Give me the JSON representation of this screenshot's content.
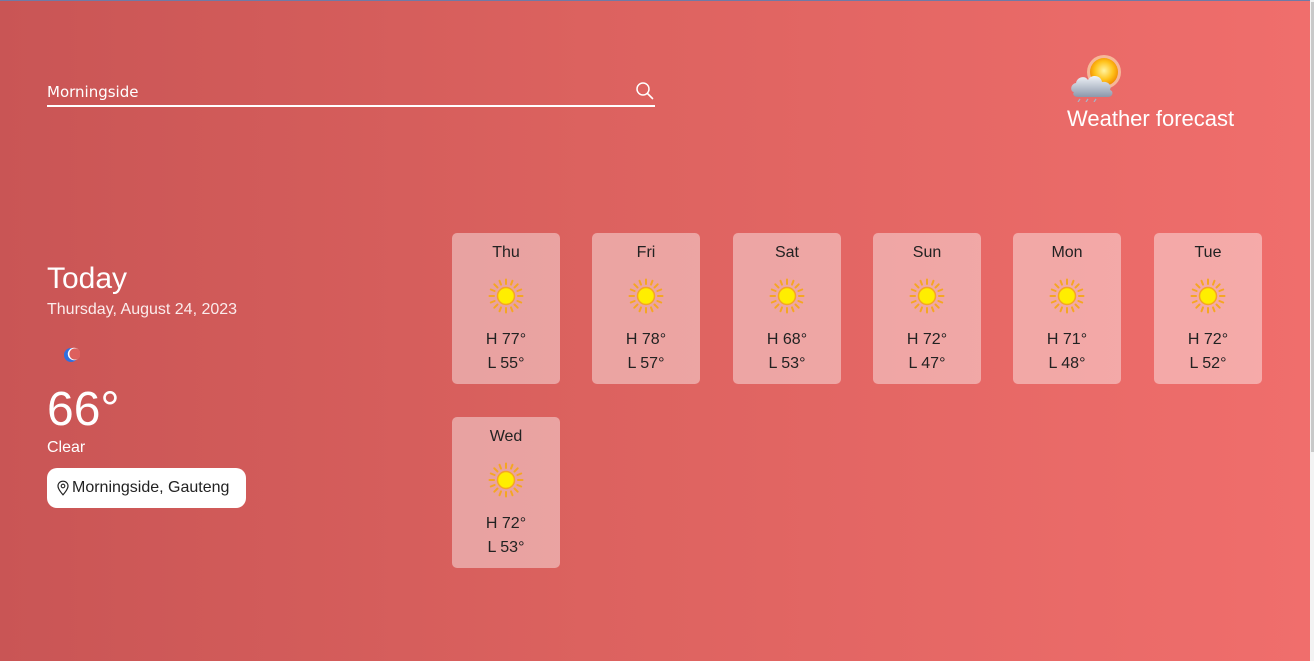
{
  "search": {
    "value": "Morningside",
    "placeholder": ""
  },
  "brand": {
    "title": "Weather forecast",
    "logo": "sun-behind-cloud-icon"
  },
  "today": {
    "title": "Today",
    "date": "Thursday, August 24, 2023",
    "icon": "moon-icon",
    "temperature": "66°",
    "condition": "Clear",
    "location": "Morningside, Gauteng"
  },
  "forecast": [
    {
      "day": "Thu",
      "high": "H 77°",
      "low": "L 55°",
      "icon": "sun-icon"
    },
    {
      "day": "Fri",
      "high": "H 78°",
      "low": "L 57°",
      "icon": "sun-icon"
    },
    {
      "day": "Sat",
      "high": "H 68°",
      "low": "L 53°",
      "icon": "sun-icon"
    },
    {
      "day": "Sun",
      "high": "H 72°",
      "low": "L 47°",
      "icon": "sun-icon"
    },
    {
      "day": "Mon",
      "high": "H 71°",
      "low": "L 48°",
      "icon": "sun-icon"
    },
    {
      "day": "Tue",
      "high": "H 72°",
      "low": "L 52°",
      "icon": "sun-icon"
    },
    {
      "day": "Wed",
      "high": "H 72°",
      "low": "L 53°",
      "icon": "sun-icon"
    }
  ],
  "colors": {
    "background_start": "#c95555",
    "background_end": "#f06e6c",
    "sun_core": "#ffee00",
    "sun_rays": "#f5a623",
    "moon": "#2f6fe0"
  }
}
